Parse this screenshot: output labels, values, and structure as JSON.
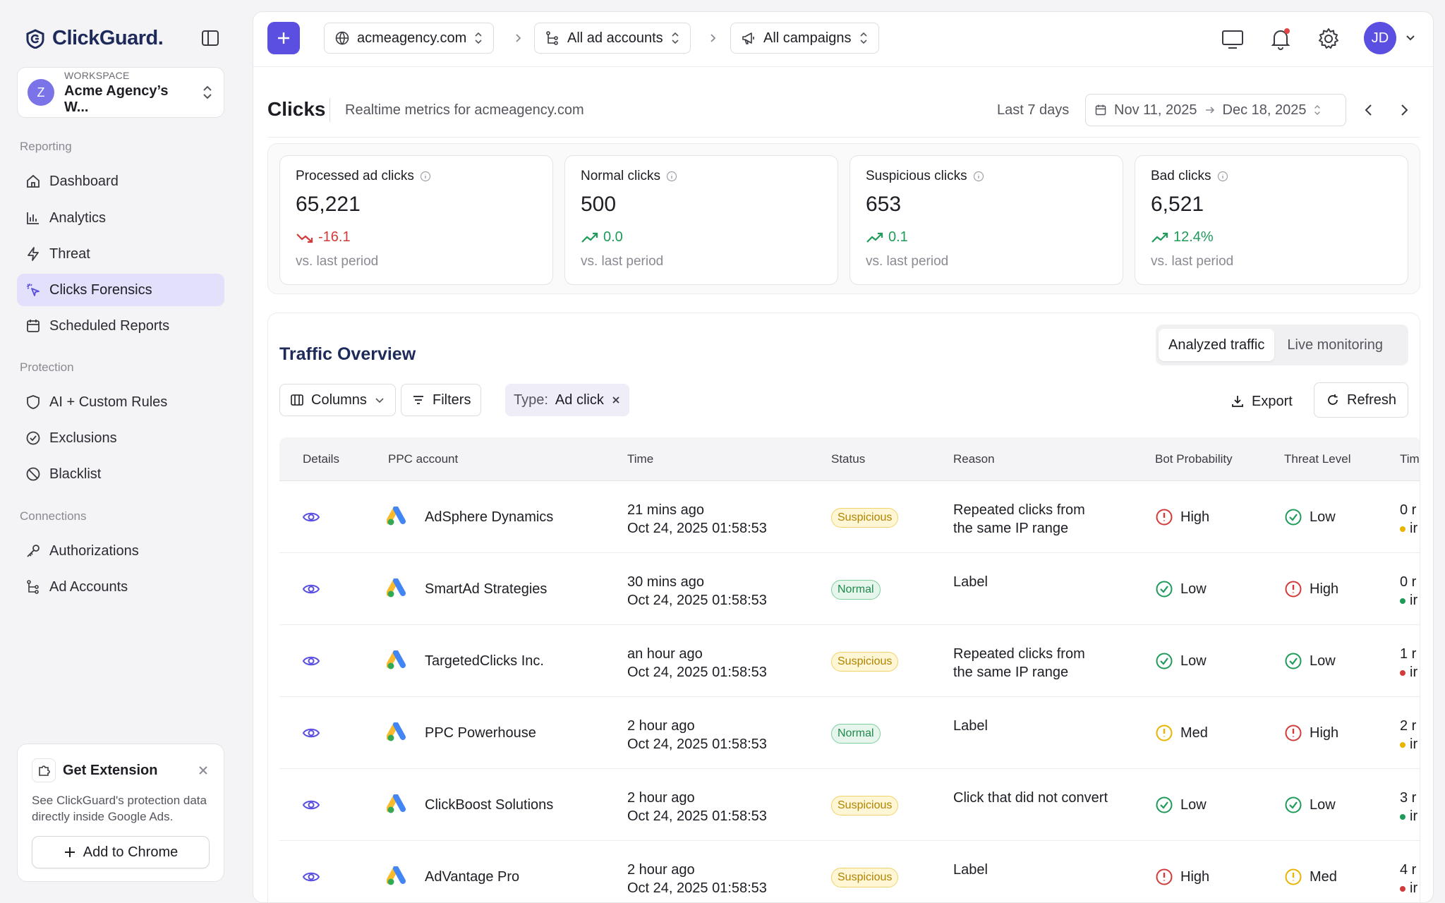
{
  "brand": {
    "name": "ClickGuard."
  },
  "workspace": {
    "label": "WORKSPACE",
    "name": "Acme Agency’s W...",
    "initial": "Z"
  },
  "sidebar": {
    "sections": [
      {
        "label": "Reporting"
      },
      {
        "label": "Protection"
      },
      {
        "label": "Connections"
      }
    ],
    "items": [
      {
        "label": "Dashboard",
        "icon": "home-icon"
      },
      {
        "label": "Analytics",
        "icon": "bar-chart-icon"
      },
      {
        "label": "Threat",
        "icon": "bolt-icon"
      },
      {
        "label": "Clicks Forensics",
        "icon": "sparkle-cursor-icon",
        "active": true
      },
      {
        "label": "Scheduled Reports",
        "icon": "calendar-icon"
      },
      {
        "label": "AI + Custom Rules",
        "icon": "shield-icon"
      },
      {
        "label": "Exclusions",
        "icon": "check-circle-icon"
      },
      {
        "label": "Blacklist",
        "icon": "ban-icon"
      },
      {
        "label": "Authorizations",
        "icon": "key-icon"
      },
      {
        "label": "Ad Accounts",
        "icon": "hierarchy-icon"
      }
    ],
    "extension": {
      "title": "Get Extension",
      "desc": "See ClickGuard's protection data directly inside Google Ads.",
      "button": "Add to Chrome"
    }
  },
  "topbar": {
    "domain": "acmeagency.com",
    "accounts": "All ad accounts",
    "campaigns": "All campaigns",
    "user_initials": "JD"
  },
  "header": {
    "title": "Clicks",
    "subtitle": "Realtime metrics for acmeagency.com",
    "range_label": "Last 7 days",
    "date_from": "Nov 11, 2025",
    "date_to": "Dec 18, 2025"
  },
  "stats": [
    {
      "label": "Processed ad clicks",
      "value": "65,221",
      "delta": "-16.1",
      "direction": "down",
      "foot": "vs. last period"
    },
    {
      "label": "Normal clicks",
      "value": "500",
      "delta": "0.0",
      "direction": "up",
      "foot": "vs. last period"
    },
    {
      "label": "Suspicious clicks",
      "value": "653",
      "delta": "0.1",
      "direction": "up",
      "foot": "vs. last period"
    },
    {
      "label": "Bad clicks",
      "value": "6,521",
      "delta": "12.4%",
      "direction": "up",
      "foot": "vs. last period"
    }
  ],
  "traffic": {
    "title": "Traffic Overview",
    "tabs": [
      "Analyzed traffic",
      "Live monitoring"
    ],
    "columns_btn": "Columns",
    "filters_btn": "Filters",
    "chip_key": "Type:",
    "chip_value": "Ad click",
    "export_btn": "Export",
    "refresh_btn": "Refresh",
    "headers": [
      "Details",
      "PPC account",
      "Time",
      "Status",
      "Reason",
      "Bot Probability",
      "Threat Level",
      "Tim"
    ],
    "rows": [
      {
        "account": "AdSphere Dynamics",
        "ago": "21 mins ago",
        "date": "Oct 24, 2025 01:58:53",
        "status": "Suspicious",
        "reason": "Repeated clicks from the same IP range",
        "bot": "High",
        "threat": "Low",
        "t1": "0 r",
        "t2": "ir",
        "dot": "#e8b400"
      },
      {
        "account": "SmartAd Strategies",
        "ago": "30 mins ago",
        "date": "Oct 24, 2025 01:58:53",
        "status": "Normal",
        "reason": "Label",
        "bot": "Low",
        "threat": "High",
        "t1": "0 r",
        "t2": "ir",
        "dot": "#1f9a5a"
      },
      {
        "account": "TargetedClicks Inc.",
        "ago": "an hour ago",
        "date": "Oct 24, 2025 01:58:53",
        "status": "Suspicious",
        "reason": "Repeated clicks from the same IP range",
        "bot": "Low",
        "threat": "Low",
        "t1": "1 r",
        "t2": "ir",
        "dot": "#d33b3b"
      },
      {
        "account": "PPC Powerhouse",
        "ago": "2 hour ago",
        "date": "Oct 24, 2025 01:58:53",
        "status": "Normal",
        "reason": "Label",
        "bot": "Med",
        "threat": "High",
        "t1": "2 r",
        "t2": "ir",
        "dot": "#e8b400"
      },
      {
        "account": "ClickBoost Solutions",
        "ago": "2 hour ago",
        "date": "Oct 24, 2025 01:58:53",
        "status": "Suspicious",
        "reason": "Click that did not convert",
        "bot": "Low",
        "threat": "Low",
        "t1": "3 r",
        "t2": "ir",
        "dot": "#1f9a5a"
      },
      {
        "account": "AdVantage Pro",
        "ago": "2 hour ago",
        "date": "Oct 24, 2025 01:58:53",
        "status": "Suspicious",
        "reason": "Label",
        "bot": "High",
        "threat": "Med",
        "t1": "4 r",
        "t2": "ir",
        "dot": "#d33b3b"
      }
    ]
  },
  "colors": {
    "accent": "#5a4fe0",
    "active_nav": "#e2e0fa",
    "high": "#d33b3b",
    "low": "#1f9a5a",
    "med": "#e8b400"
  }
}
